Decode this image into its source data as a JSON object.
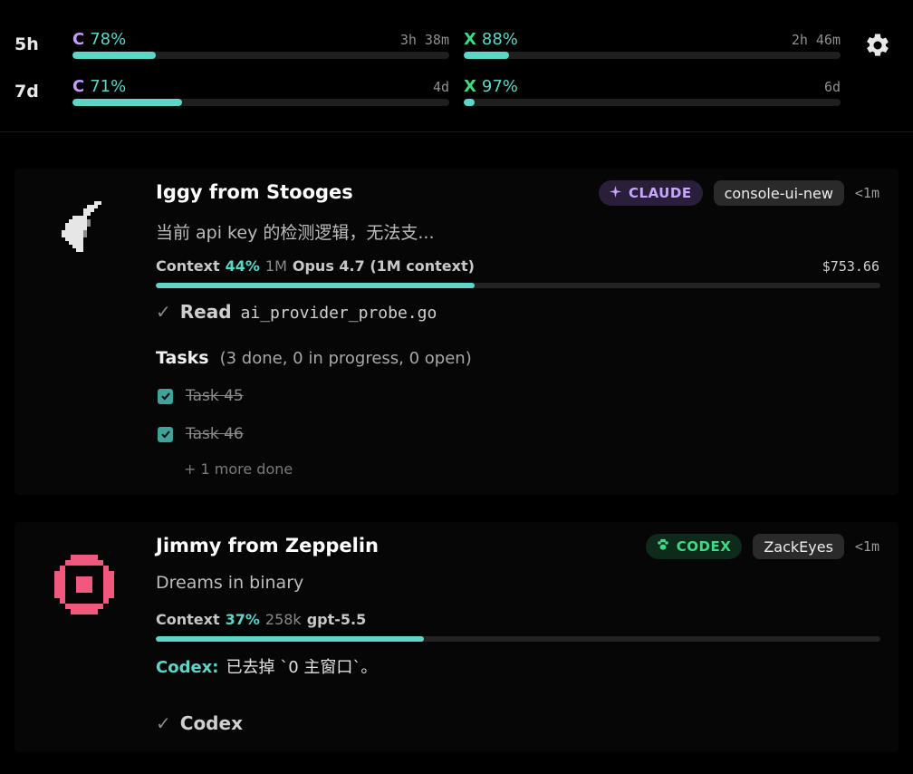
{
  "usage": {
    "rows": [
      {
        "period": "5h",
        "meters": [
          {
            "letter": "C",
            "percent": "78%",
            "time": "3h 38m",
            "fill": 0.22,
            "letter_color": "#c49bff"
          },
          {
            "letter": "X",
            "percent": "88%",
            "time": "2h 46m",
            "fill": 0.12,
            "letter_color": "#3ddc84"
          }
        ]
      },
      {
        "period": "7d",
        "meters": [
          {
            "letter": "C",
            "percent": "71%",
            "time": "4d",
            "fill": 0.29,
            "letter_color": "#c49bff"
          },
          {
            "letter": "X",
            "percent": "97%",
            "time": "6d",
            "fill": 0.03,
            "letter_color": "#3ddc84"
          }
        ]
      }
    ],
    "settings_icon": "gear-icon"
  },
  "sessions": [
    {
      "title": "Iggy from Stooges",
      "agent": "CLAUDE",
      "agent_icon": "sparkle-icon",
      "repo": "console-ui-new",
      "age": "<1m",
      "subtitle": "当前 api key 的检测逻辑，无法支...",
      "context_label": "Context",
      "context_percent": "44%",
      "context_fill": 0.44,
      "context_window": "1M",
      "model": "Opus 4.7 (1M context)",
      "cost": "$753.66",
      "activity": {
        "check": "✓",
        "verb": "Read",
        "arg": "ai_provider_probe.go"
      },
      "tasks_title": "Tasks",
      "tasks_summary": "(3 done, 0 in progress, 0 open)",
      "tasks": [
        "Task 45",
        "Task 46"
      ],
      "more": "+ 1 more done"
    },
    {
      "title": "Jimmy from Zeppelin",
      "agent": "CODEX",
      "agent_icon": "paw-icon",
      "repo": "ZackEyes",
      "age": "<1m",
      "subtitle": "Dreams in binary",
      "context_label": "Context",
      "context_percent": "37%",
      "context_fill": 0.37,
      "context_window": "258k",
      "model": "gpt-5.5",
      "message": {
        "who": "Codex:",
        "text": "已去掉 `0 主窗口`。"
      },
      "activity": {
        "check": "✓",
        "verb": "Codex"
      }
    }
  ],
  "colors": {
    "accent": "#5dd6c8",
    "claude": "#c7a6ff",
    "codex": "#3ddc84",
    "avatar_pink": "#f0587e"
  }
}
